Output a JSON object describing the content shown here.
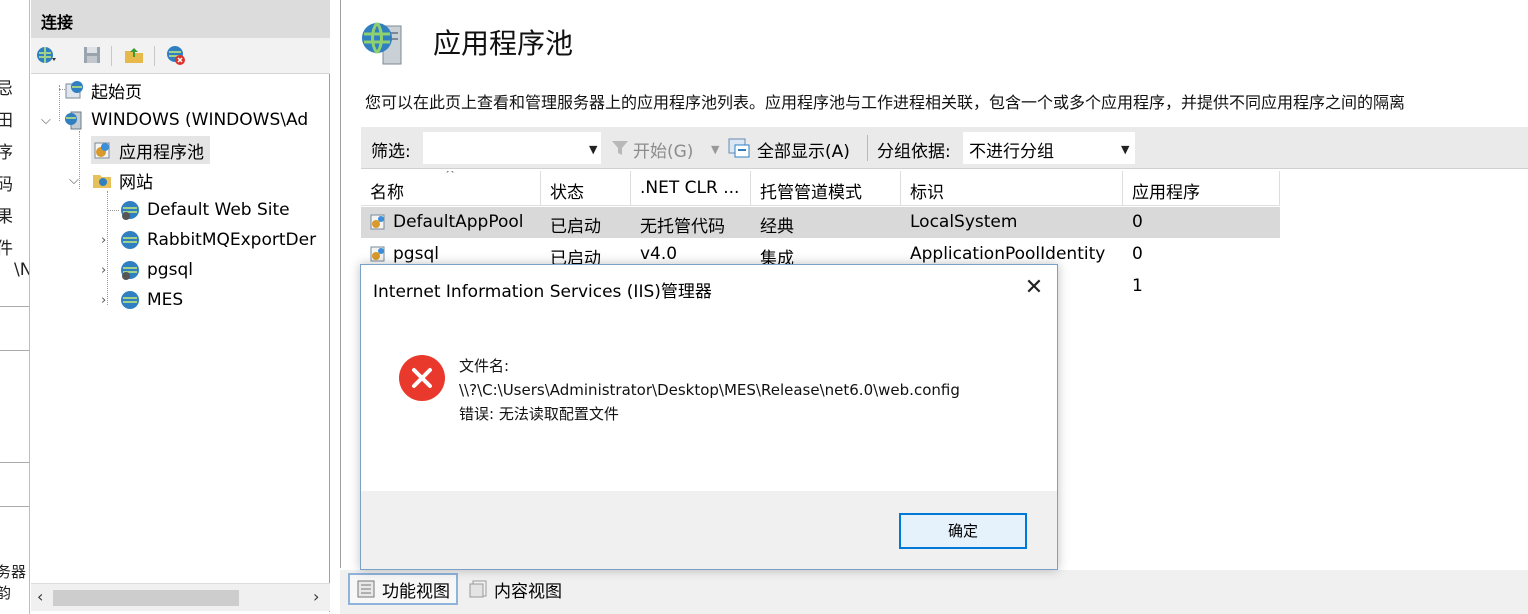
{
  "left_strip": {
    "chars": [
      "忌",
      "田",
      "序",
      "码",
      "果",
      "件",
      "\\N"
    ],
    "bottom_text": "务器韵"
  },
  "connections": {
    "title": "连接",
    "tree": [
      {
        "label": "起始页"
      },
      {
        "label": "WINDOWS (WINDOWS\\Ad"
      },
      {
        "label": "应用程序池"
      },
      {
        "label": "网站"
      },
      {
        "label": "Default Web Site"
      },
      {
        "label": "RabbitMQExportDer"
      },
      {
        "label": "pgsql"
      },
      {
        "label": "MES"
      }
    ]
  },
  "main": {
    "title": "应用程序池",
    "description": "您可以在此页上查看和管理服务器上的应用程序池列表。应用程序池与工作进程相关联，包含一个或多个应用程序，并提供不同应用程序之间的隔离",
    "filterbar": {
      "filter_label": "筛选:",
      "start_label": "开始(G)",
      "show_all_label": "全部显示(A)",
      "group_label": "分组依据:",
      "group_value": "不进行分组"
    },
    "columns": [
      "名称",
      "状态",
      ".NET CLR ...",
      "托管管道模式",
      "标识",
      "应用程序"
    ],
    "rows": [
      {
        "name": "DefaultAppPool",
        "status": "已启动",
        "clr": "无托管代码",
        "pipeline": "经典",
        "identity": "LocalSystem",
        "apps": "0"
      },
      {
        "name": "pgsql",
        "status": "已启动",
        "clr": "v4.0",
        "pipeline": "集成",
        "identity": "ApplicationPoolIdentity",
        "apps": "0"
      },
      {
        "name": "",
        "status": "",
        "clr": "",
        "pipeline": "",
        "identity": "dentity",
        "apps": "1"
      }
    ]
  },
  "bottom_tabs": {
    "features_view": "功能视图",
    "content_view": "内容视图"
  },
  "dialog": {
    "title": "Internet Information Services (IIS)管理器",
    "line1": "文件名:",
    "line2": "\\\\?\\C:\\Users\\Administrator\\Desktop\\MES\\Release\\net6.0\\web.config",
    "line3": "错误: 无法读取配置文件",
    "ok_label": "确定",
    "close_glyph": "✕"
  },
  "colors": {
    "accent": "#0078d7",
    "error": "#e8392c",
    "selection": "#d9d9d9"
  }
}
